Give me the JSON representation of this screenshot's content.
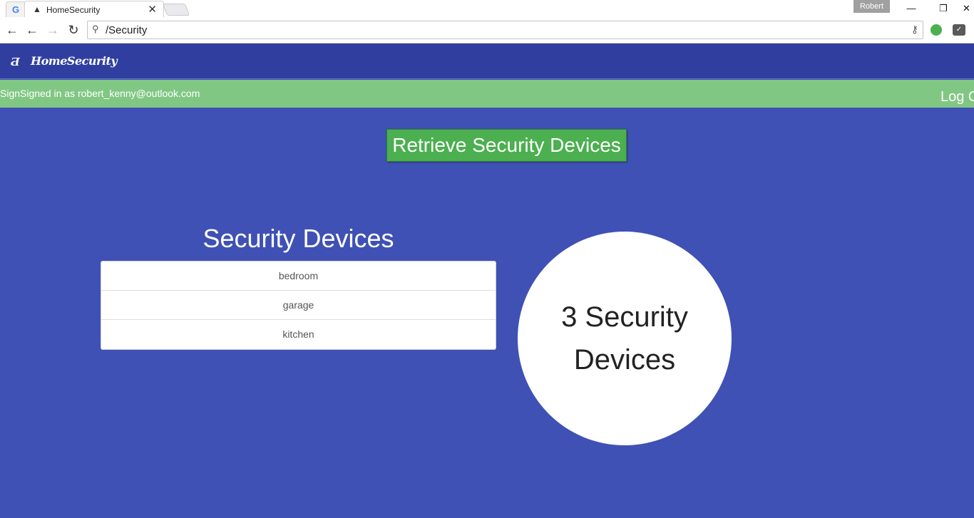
{
  "browser": {
    "tab_title": "HomeSecurity",
    "google_tab_glyph": "G",
    "tab_close": "✕",
    "profile_name": "Robert",
    "address": "/Security",
    "window_controls": {
      "minimize": "—",
      "restore": "❐",
      "close": "✕"
    },
    "icons": [
      "google-icon",
      "security-camera-icon",
      "back-icon",
      "forward-icon",
      "reload-icon",
      "search-icon",
      "key-icon",
      "evernote-icon",
      "pocket-icon"
    ]
  },
  "app": {
    "brand_icon": "Ƌ",
    "brand": "HomeSecurity",
    "signed_in_text": "SignSigned in as robert_kenny@outlook.com",
    "logout_label": "Log O",
    "retrieve_button": "Retrieve Security Devices",
    "list_title": "Security Devices",
    "devices": [
      "bedroom",
      "garage",
      "kitchen"
    ],
    "count_text": "3 Security Devices"
  },
  "colors": {
    "page_bg": "#3f51b5",
    "appbar_bg": "#303f9f",
    "status_bg": "#81c784",
    "button_bg": "#4caf50"
  }
}
